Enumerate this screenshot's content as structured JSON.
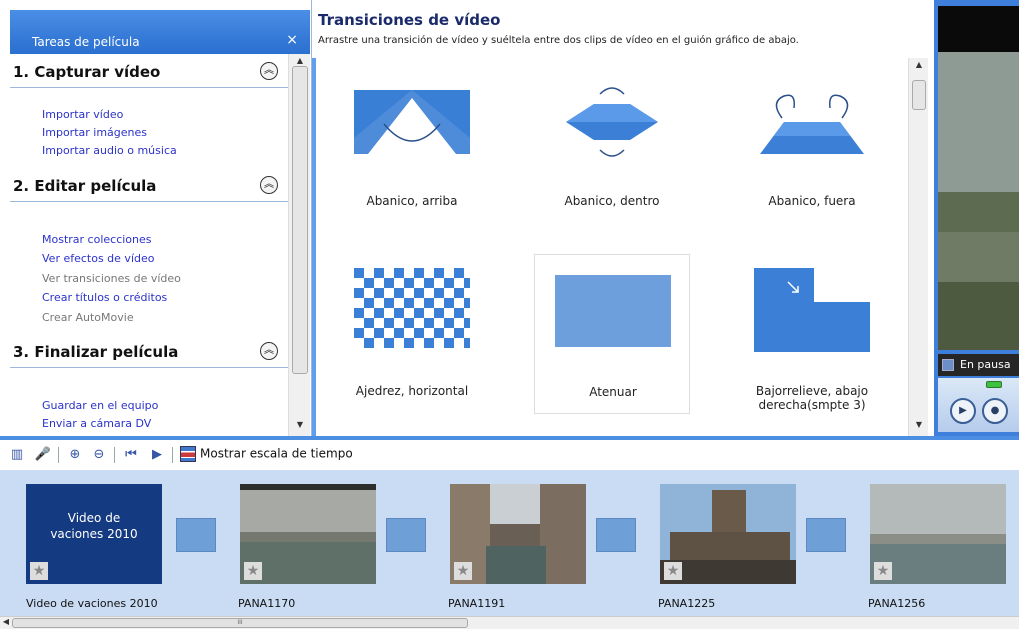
{
  "task_pane": {
    "title": "Tareas de película",
    "close_glyph": "×",
    "sections": [
      {
        "heading": "1. Capturar vídeo",
        "links": [
          "Importar vídeo",
          "Importar imágenes",
          "Importar audio o música"
        ]
      },
      {
        "heading": "2. Editar película",
        "links": [
          "Mostrar colecciones",
          "Ver efectos de vídeo",
          "Ver transiciones de vídeo",
          "Crear títulos o créditos",
          "Crear AutoMovie"
        ]
      },
      {
        "heading": "3. Finalizar película",
        "links": [
          "Guardar en el equipo",
          "Enviar a cámara DV"
        ]
      }
    ]
  },
  "collection": {
    "title": "Transiciones de vídeo",
    "subtitle": "Arrastre una transición de vídeo y suéltela entre dos clips de vídeo en el guión gráfico de abajo.",
    "items": [
      "Abanico, arriba",
      "Abanico, dentro",
      "Abanico, fuera",
      "Ajedrez, horizontal",
      "Atenuar",
      "Bajorrelieve, abajo derecha(smpte 3)"
    ]
  },
  "monitor": {
    "status": "En pausa"
  },
  "storyboard": {
    "timeline_button": "Mostrar escala de tiempo",
    "title_clip_text": "Video de vaciones 2010",
    "clips": [
      "Video de vaciones 2010",
      "PANA1170",
      "PANA1191",
      "PANA1225",
      "PANA1256"
    ],
    "scroll_thumb_glyph": "III"
  },
  "colors": {
    "accent": "#3f7fdc",
    "link": "#2b32c9",
    "storyboard_bg": "#c9dcf3",
    "transition_blue": "#3b7fd6"
  }
}
